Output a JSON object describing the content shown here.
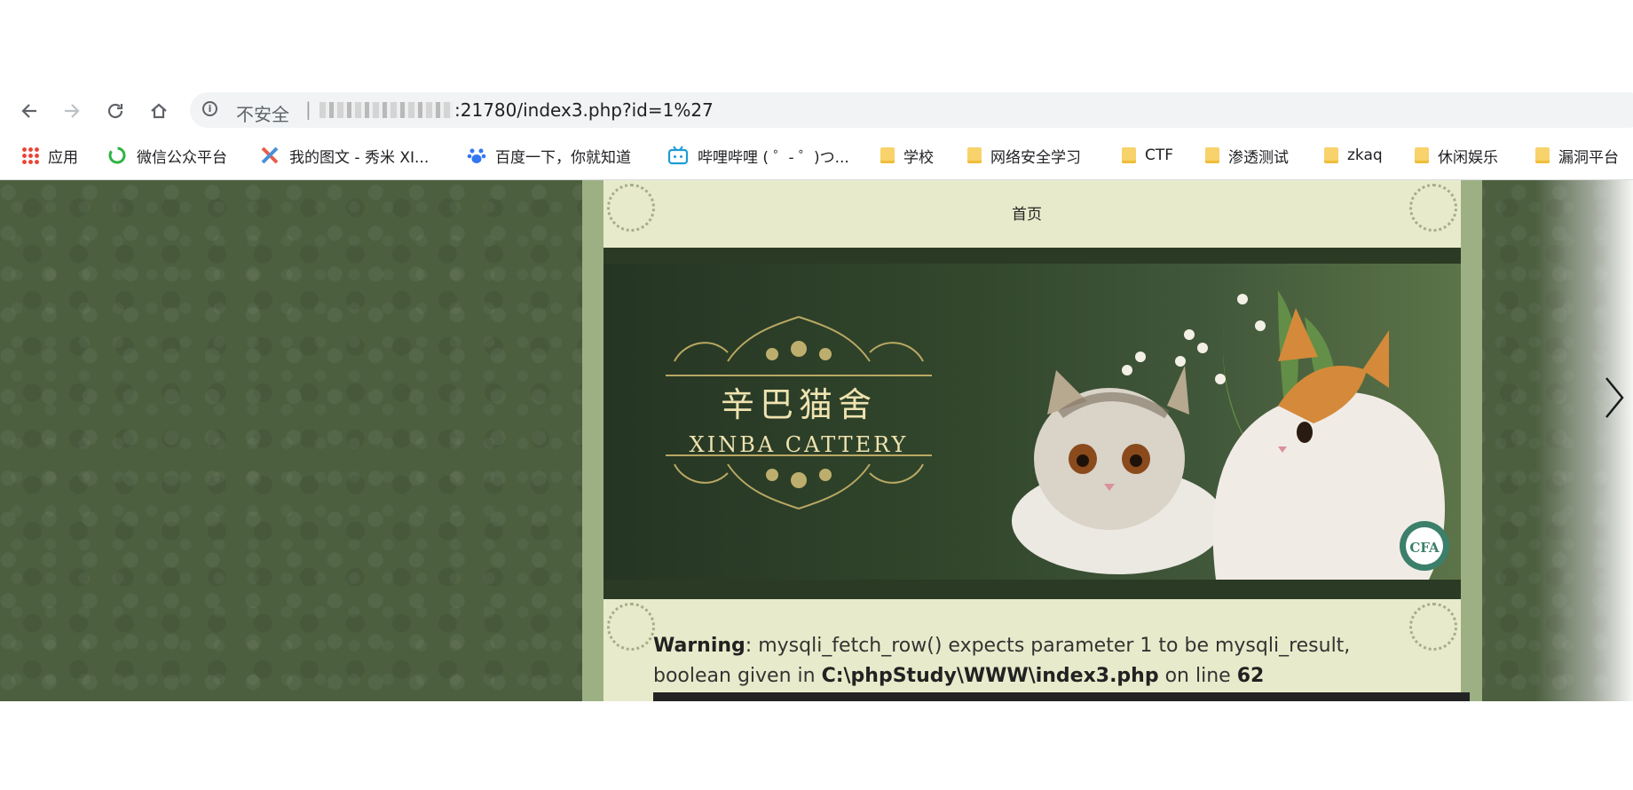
{
  "browser": {
    "back_icon": "arrow-left-icon",
    "forward_icon": "arrow-right-icon",
    "reload_icon": "reload-icon",
    "home_icon": "home-icon",
    "security_label": "不安全",
    "separator": "|",
    "url_visible": ":21780/index3.php?id=1%27"
  },
  "bookmarks": [
    {
      "label": "应用",
      "icon": "apps-grid-icon"
    },
    {
      "label": "微信公众平台",
      "icon": "wechat-mp-icon"
    },
    {
      "label": "我的图文 - 秀米 XI...",
      "icon": "xiumi-icon"
    },
    {
      "label": "百度一下，你就知道",
      "icon": "baidu-paw-icon"
    },
    {
      "label": "哔哩哔哩 ( ゜- ゜)つ...",
      "icon": "bilibili-icon"
    },
    {
      "label": "学校",
      "icon": "folder-icon"
    },
    {
      "label": "网络安全学习",
      "icon": "folder-icon"
    },
    {
      "label": "CTF",
      "icon": "folder-icon"
    },
    {
      "label": "渗透测试",
      "icon": "folder-icon"
    },
    {
      "label": "zkaq",
      "icon": "folder-icon"
    },
    {
      "label": "休闲娱乐",
      "icon": "folder-icon"
    },
    {
      "label": "漏洞平台",
      "icon": "folder-icon"
    }
  ],
  "site": {
    "nav_home": "首页",
    "banner_title_cn": "辛巴猫舍",
    "banner_title_en": "XINBA CATTERY",
    "badge_text": "CFA",
    "warning": {
      "label": "Warning",
      "message_before": ": mysqli_fetch_row() expects parameter 1 to be mysqli_result, boolean given in ",
      "file": "C:\\phpStudy\\WWW\\index3.php",
      "message_mid": " on line ",
      "line": "62"
    }
  },
  "colors": {
    "page_bg": "#4c5f3f",
    "frame": "#9db084",
    "content_bg": "#e8ebcb",
    "banner_text": "#efe3b0"
  }
}
